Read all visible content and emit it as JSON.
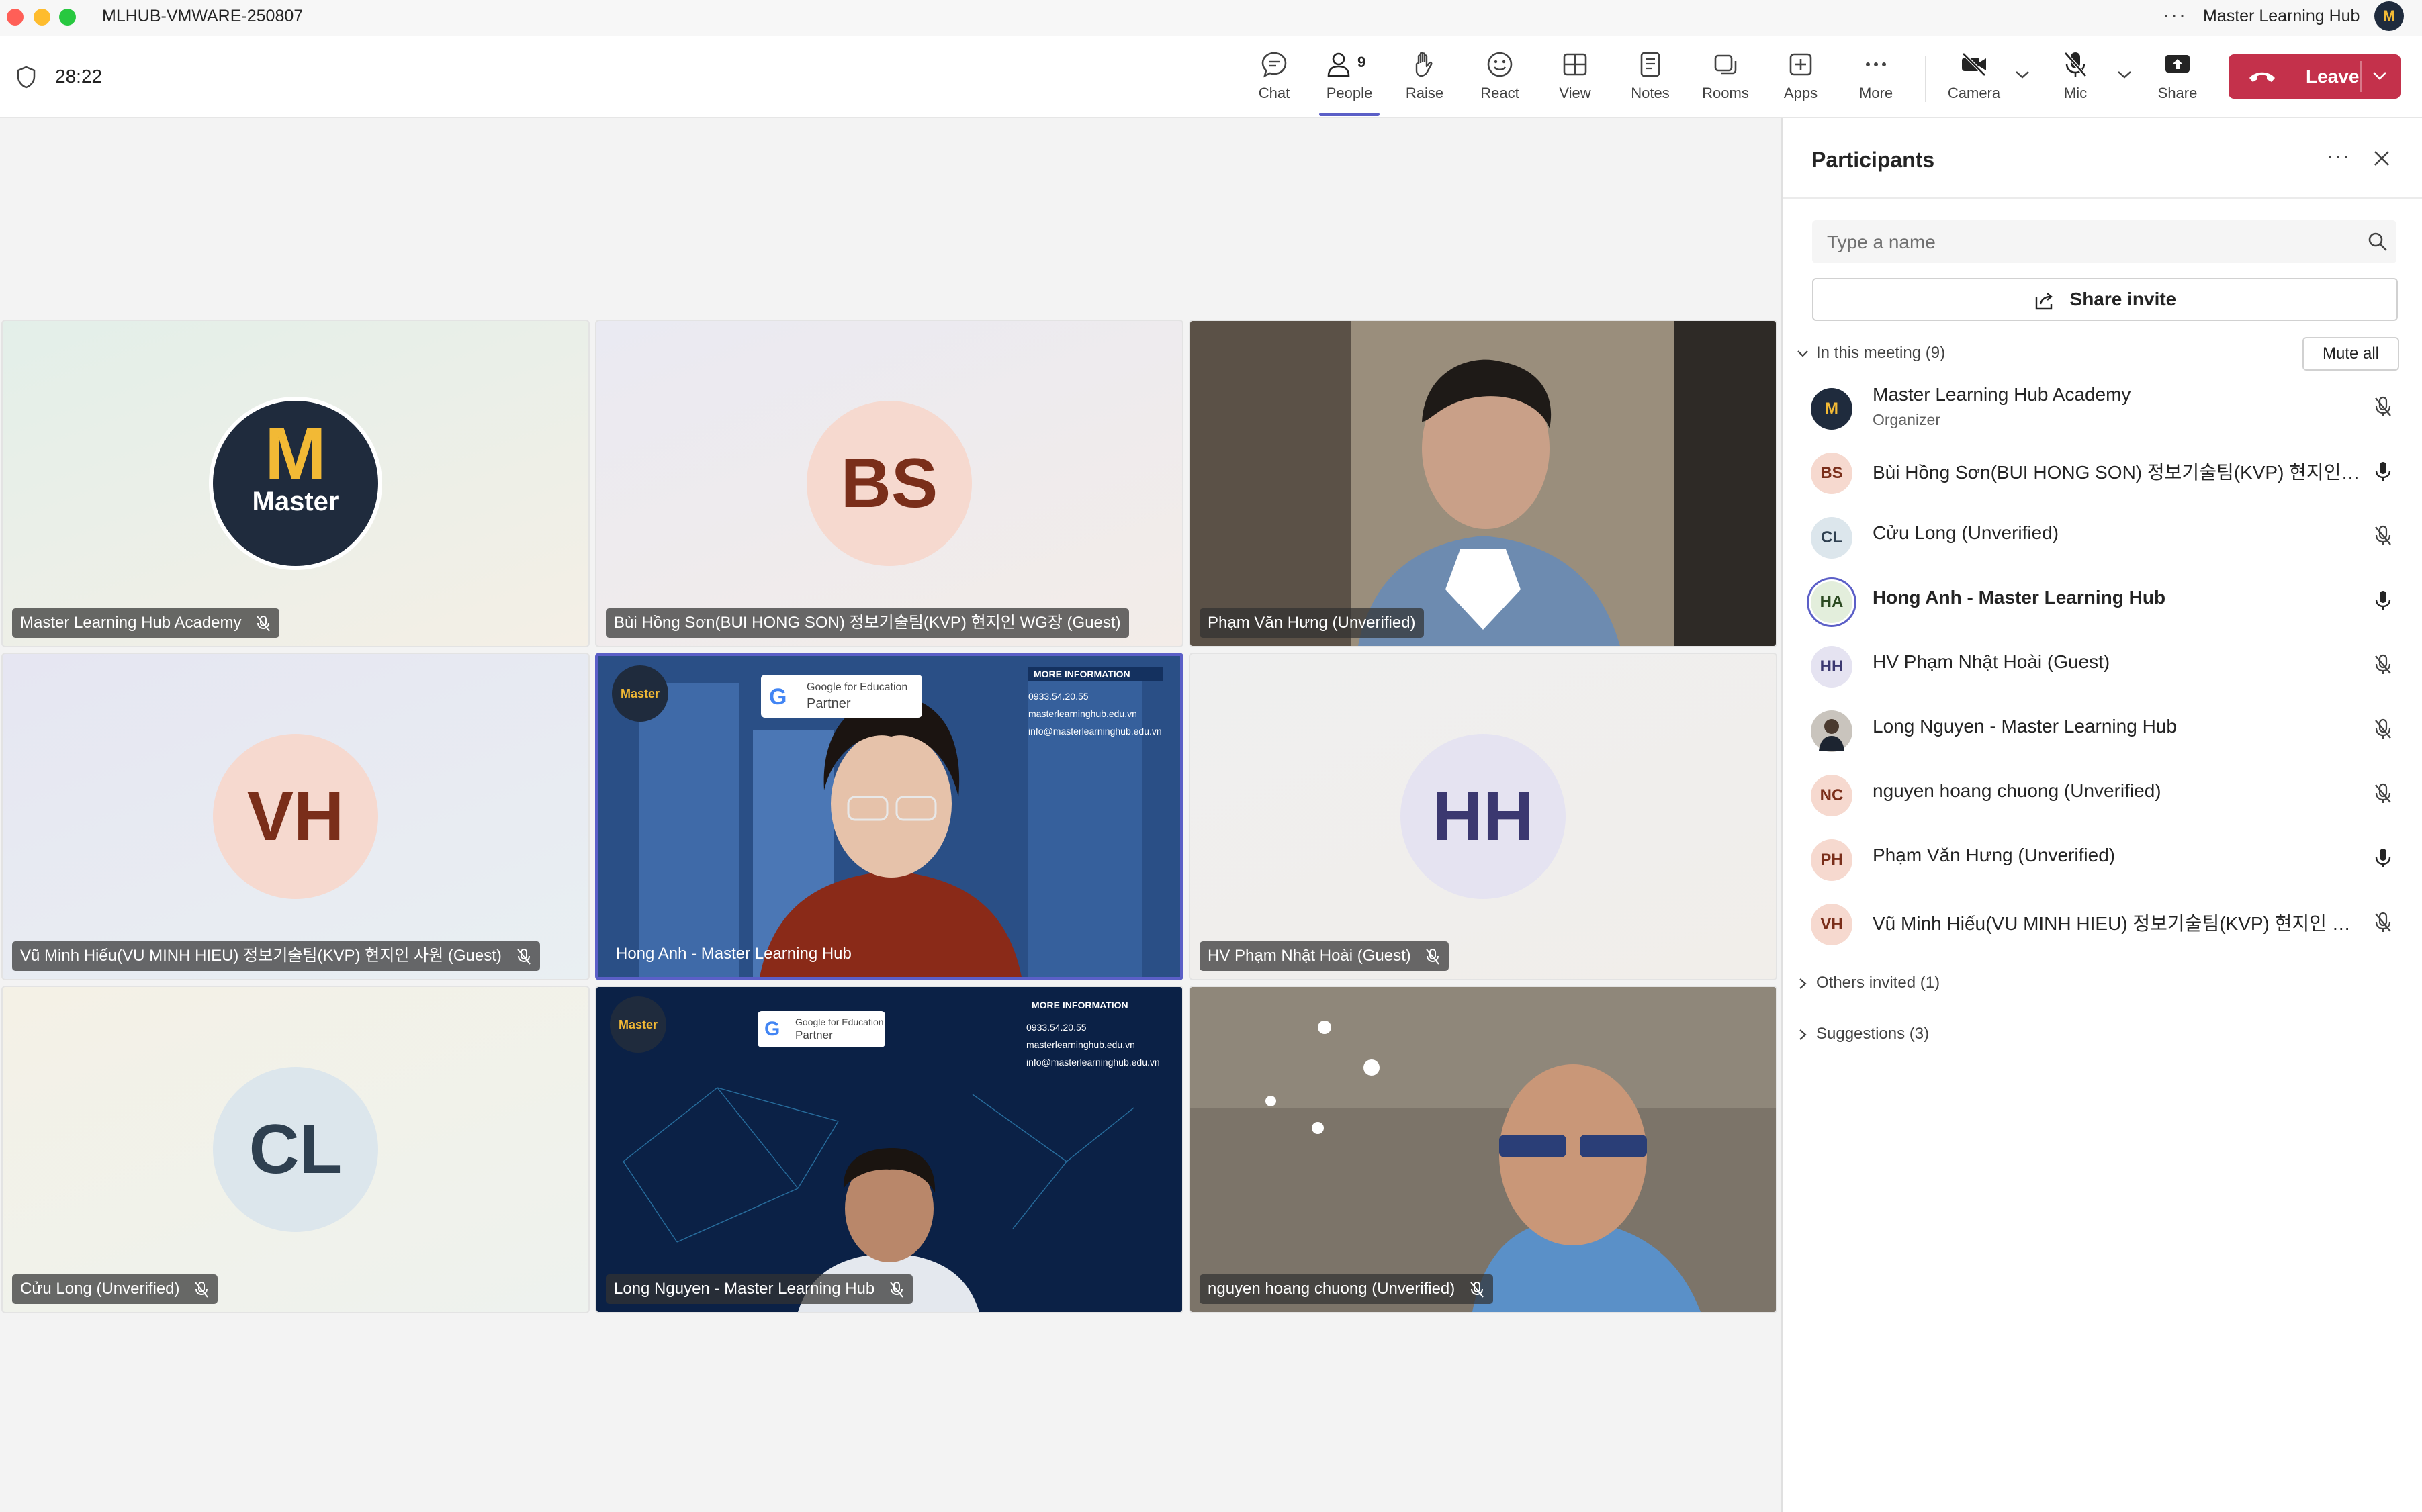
{
  "window": {
    "title": "MLHUB-VMWARE-250807",
    "account_name": "Master Learning Hub",
    "account_avatar_text": "M"
  },
  "toolbar": {
    "timer": "28:22",
    "buttons": {
      "chat": "Chat",
      "people": "People",
      "people_count": "9",
      "raise": "Raise",
      "react": "React",
      "view": "View",
      "notes": "Notes",
      "rooms": "Rooms",
      "apps": "Apps",
      "more": "More",
      "camera": "Camera",
      "mic": "Mic",
      "share": "Share",
      "leave": "Leave"
    }
  },
  "tiles": [
    {
      "name": "Master Learning Hub Academy",
      "avatar_text": "M",
      "avatar_sub": "Master",
      "muted": true,
      "kind": "logo"
    },
    {
      "name": "Bùi Hồng Sơn(BUI HONG SON) 정보기술팀(KVP) 현지인 WG장 (Guest)",
      "avatar_text": "BS",
      "muted": false,
      "kind": "initials"
    },
    {
      "name": "Phạm Văn Hưng (Unverified)",
      "muted": false,
      "kind": "video"
    },
    {
      "name": "Vũ Minh Hiếu(VU MINH HIEU) 정보기술팀(KVP) 현지인 사원 (Guest)",
      "avatar_text": "VH",
      "muted": true,
      "kind": "initials"
    },
    {
      "name": "Hong Anh - Master Learning Hub",
      "muted": false,
      "kind": "video",
      "overlay": {
        "logo": "Master",
        "brand": "Google for Education",
        "brand_sub": "Partner",
        "info_title": "MORE INFORMATION",
        "phone": "0933.54.20.55",
        "web": "masterlearninghub.edu.vn",
        "email": "info@masterlearninghub.edu.vn"
      }
    },
    {
      "name": "HV Phạm Nhật Hoài (Guest)",
      "avatar_text": "HH",
      "muted": true,
      "kind": "initials"
    },
    {
      "name": "Cửu Long (Unverified)",
      "avatar_text": "CL",
      "muted": true,
      "kind": "initials"
    },
    {
      "name": "Long Nguyen - Master Learning Hub",
      "muted": true,
      "kind": "video",
      "overlay": {
        "logo": "Master",
        "brand": "Google for Education",
        "brand_sub": "Partner",
        "info_title": "MORE INFORMATION",
        "phone": "0933.54.20.55",
        "web": "masterlearninghub.edu.vn",
        "email": "info@masterlearninghub.edu.vn"
      }
    },
    {
      "name": "nguyen hoang chuong (Unverified)",
      "muted": true,
      "kind": "video"
    }
  ],
  "panel": {
    "title": "Participants",
    "search_placeholder": "Type a name",
    "share_invite": "Share invite",
    "in_meeting": "In this meeting (9)",
    "mute_all": "Mute all",
    "others_invited": "Others invited (1)",
    "suggestions": "Suggestions (3)",
    "participants": [
      {
        "initials": "M",
        "name": "Master Learning Hub Academy",
        "role": "Organizer",
        "muted": true,
        "avatar_bg": "#1f2b3d",
        "avatar_fg": "#f2b935"
      },
      {
        "initials": "BS",
        "name": "Bùi Hồng Sơn(BUI HONG SON) 정보기술팀(KVP) 현지인 WG장 (Guest)",
        "muted": false,
        "avatar_bg": "#f6d9cf",
        "avatar_fg": "#7a2e1a"
      },
      {
        "initials": "CL",
        "name": "Cửu Long (Unverified)",
        "muted": true,
        "avatar_bg": "#dce6ec",
        "avatar_fg": "#2f4050"
      },
      {
        "initials": "HA",
        "name": "Hong Anh - Master Learning Hub",
        "muted": false,
        "bold": true,
        "avatar_bg": "#e3eedc",
        "avatar_fg": "#2c4a22"
      },
      {
        "initials": "HH",
        "name": "HV Phạm Nhật Hoài (Guest)",
        "muted": true,
        "avatar_bg": "#e5e3f1",
        "avatar_fg": "#3b3870"
      },
      {
        "initials": "",
        "name": "Long Nguyen - Master Learning Hub",
        "muted": true,
        "photo": true,
        "avatar_bg": "#c9c4bd",
        "avatar_fg": "#333333"
      },
      {
        "initials": "NC",
        "name": "nguyen hoang chuong (Unverified)",
        "muted": true,
        "avatar_bg": "#f6d9cf",
        "avatar_fg": "#7a2e1a"
      },
      {
        "initials": "PH",
        "name": "Phạm Văn Hưng (Unverified)",
        "muted": false,
        "avatar_bg": "#f6d9cf",
        "avatar_fg": "#7a2e1a"
      },
      {
        "initials": "VH",
        "name": "Vũ Minh Hiếu(VU MINH HIEU) 정보기술팀(KVP) 현지인 사원 (Guest)",
        "muted": true,
        "avatar_bg": "#f6d9cf",
        "avatar_fg": "#7a2e1a"
      }
    ]
  }
}
